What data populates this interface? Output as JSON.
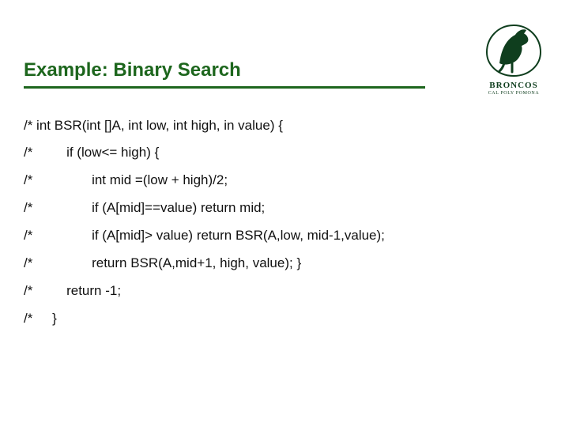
{
  "logo": {
    "text": "BRONCOS",
    "subtext": "CAL POLY POMONA"
  },
  "title": "Example: Binary Search",
  "code": {
    "l0": "/* int BSR(int []A, int low, int high, in value) {",
    "l1_pre": "/*",
    "l1": "if (low<= high) {",
    "l2_pre": "/*",
    "l2": "int mid =(low + high)/2;",
    "l3_pre": "/*",
    "l3": "if (A[mid]==value) return mid;",
    "l4_pre": "/*",
    "l4": "if (A[mid]> value) return BSR(A,low, mid-1,value);",
    "l5_pre": "/*",
    "l5": "return BSR(A,mid+1, high, value); }",
    "l6_pre": "/*",
    "l6": "return -1;",
    "l7_pre": "/*",
    "l7": "}"
  }
}
